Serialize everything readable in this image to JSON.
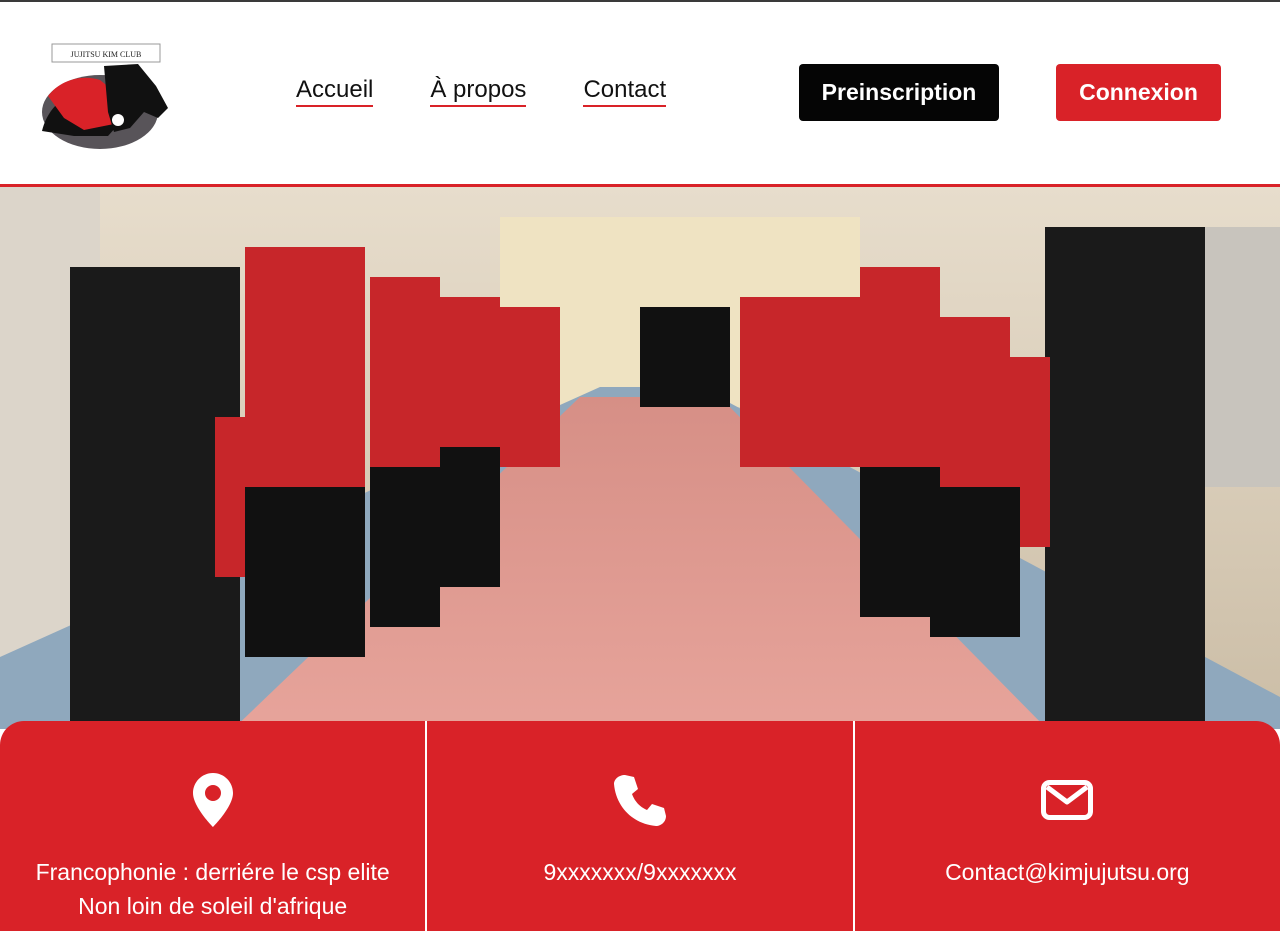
{
  "brand": {
    "logo_text": "JUJITSU KIM CLUB",
    "accent": "#d92228",
    "dark": "#050505"
  },
  "nav": {
    "items": [
      {
        "label": "Accueil"
      },
      {
        "label": "À propos"
      },
      {
        "label": "Contact"
      }
    ]
  },
  "buttons": {
    "preinscription": "Preinscription",
    "connexion": "Connexion"
  },
  "hero": {
    "image_label": "photo"
  },
  "contacts": [
    {
      "icon": "location-pin-icon",
      "line1": "Francophonie : derriére le csp elite",
      "line2": "Non loin de soleil d'afrique"
    },
    {
      "icon": "phone-icon",
      "line1": "9xxxxxxx/9xxxxxxx"
    },
    {
      "icon": "envelope-icon",
      "line1": "Contact@kimjujutsu.org"
    }
  ]
}
